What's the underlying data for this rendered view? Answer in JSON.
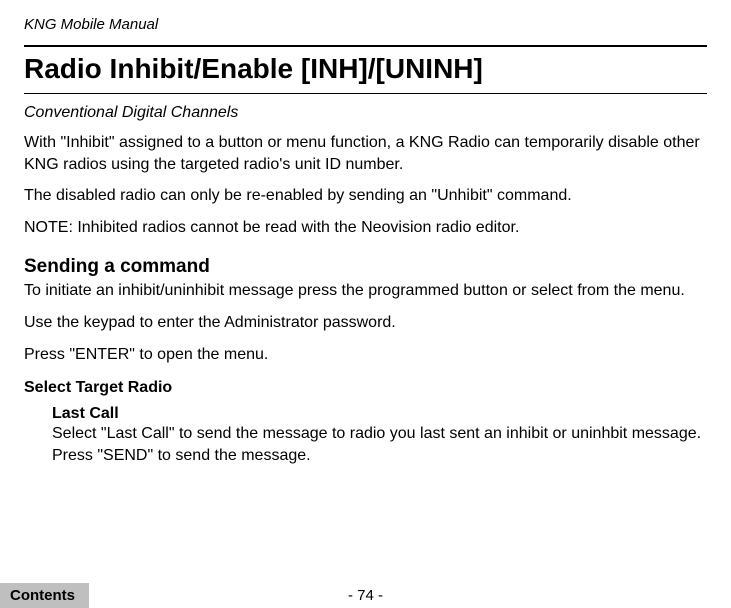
{
  "header": {
    "manual_title": "KNG Mobile Manual"
  },
  "title": "Radio Inhibit/Enable [INH]/[UNINH]",
  "subtitle": "Conventional Digital Channels",
  "intro_para_1": "With \"Inhibit\" assigned to a button or menu function, a KNG Radio can temporarily disable other KNG radios using the targeted radio's unit ID number.",
  "intro_para_2": "The disabled radio can only be re-enabled by sending an \"Unhibit\" command.",
  "intro_note": "NOTE: Inhibited radios cannot be read with the Neovision radio editor.",
  "section1": {
    "heading": "Sending a command",
    "para1": "To initiate an inhibit/uninhibit message press the programmed button or select from the menu.",
    "para2": "Use the keypad to enter the Administrator password.",
    "para3": "Press \"ENTER\" to open the menu."
  },
  "section2": {
    "heading": "Select Target Radio",
    "sub": {
      "heading": "Last Call",
      "text": "Select \"Last Call\" to send the message to radio you last sent an inhibit or uninhbit message. Press \"SEND\" to send the message."
    }
  },
  "footer": {
    "page_number": "- 74 -",
    "contents_label": "Contents"
  }
}
